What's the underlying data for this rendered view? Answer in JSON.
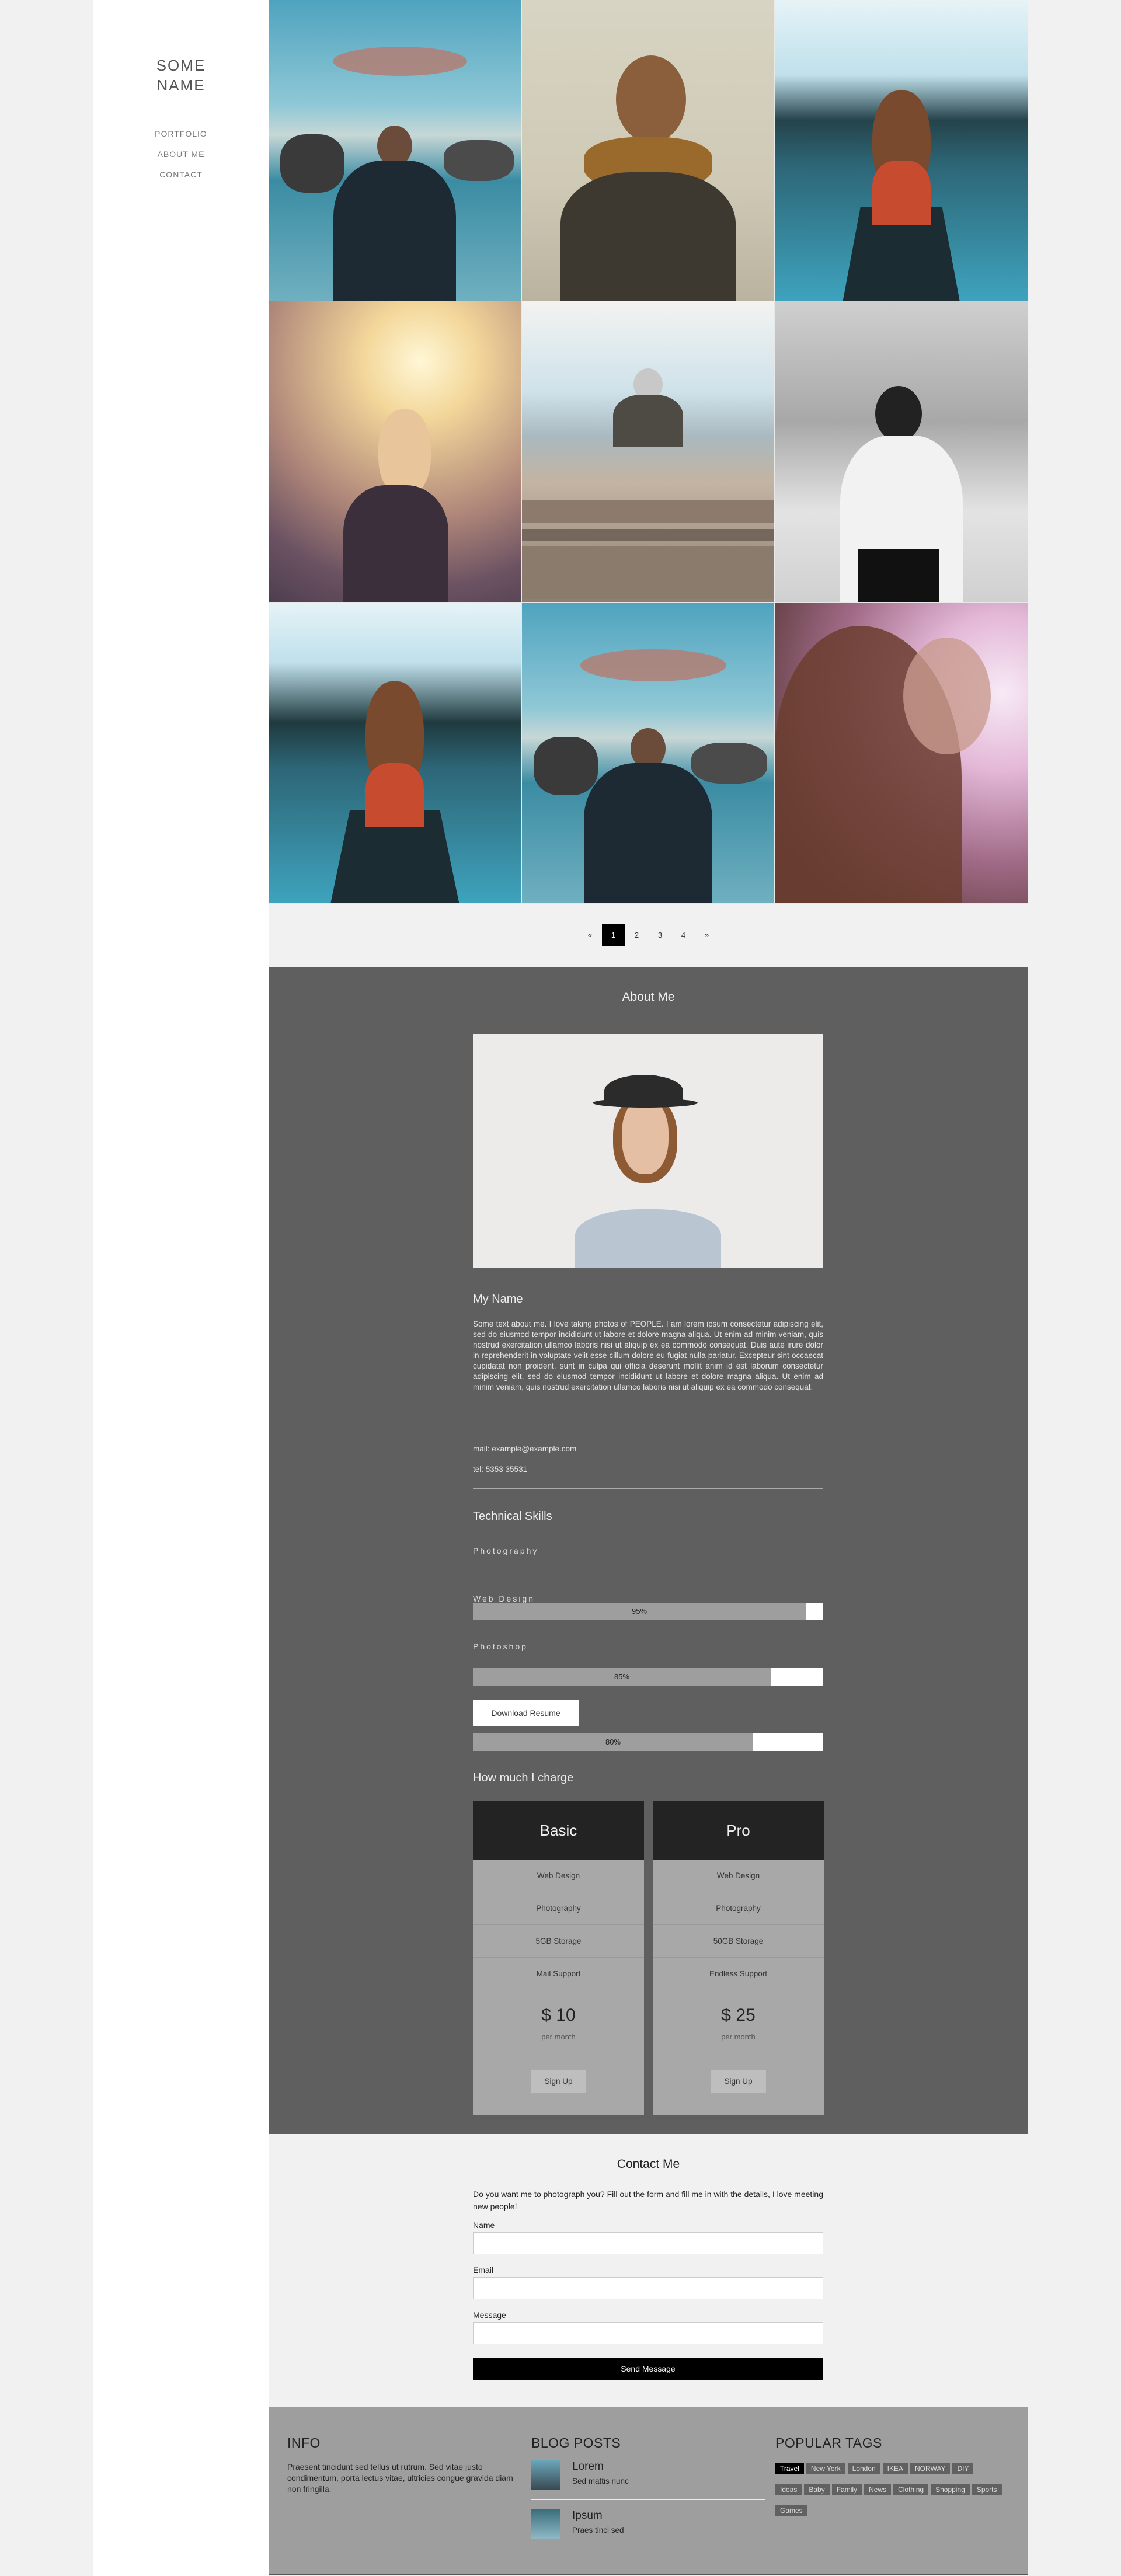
{
  "sidebar": {
    "brand_line1": "SOME",
    "brand_line2": "NAME",
    "nav": [
      "PORTFOLIO",
      "ABOUT ME",
      "CONTACT"
    ]
  },
  "pagination": {
    "prev": "«",
    "pages": [
      "1",
      "2",
      "3",
      "4"
    ],
    "active": "1",
    "next": "»"
  },
  "about": {
    "title": "About Me",
    "name": "My Name",
    "bio": "Some text about me. I love taking photos of PEOPLE. I am lorem ipsum consectetur adipiscing elit, sed do eiusmod tempor incididunt ut labore et dolore magna aliqua. Ut enim ad minim veniam, quis nostrud exercitation ullamco laboris nisi ut aliquip ex ea commodo consequat. Duis aute irure dolor in reprehenderit in voluptate velit esse cillum dolore eu fugiat nulla pariatur. Excepteur sint occaecat cupidatat non proident, sunt in culpa qui officia deserunt mollit anim id est laborum consectetur adipiscing elit, sed do eiusmod tempor incididunt ut labore et dolore magna aliqua. Ut enim ad minim veniam, quis nostrud exercitation ullamco laboris nisi ut aliquip ex ea commodo consequat.",
    "mail": "mail: example@example.com",
    "tel": "tel: 5353 35531"
  },
  "skills": {
    "title": "Technical Skills",
    "items": [
      {
        "label": "Photography",
        "value": 95,
        "text": "95%"
      },
      {
        "label": "Web Design",
        "value": 85,
        "text": "85%"
      },
      {
        "label": "Photoshop",
        "value": 80,
        "text": "80%"
      }
    ],
    "download": "Download Resume"
  },
  "pricing": {
    "title": "How much I charge",
    "plans": [
      {
        "name": "Basic",
        "features": [
          "Web Design",
          "Photography",
          "5GB Storage",
          "Mail Support"
        ],
        "price": "$ 10",
        "per": "per month",
        "cta": "Sign Up"
      },
      {
        "name": "Pro",
        "features": [
          "Web Design",
          "Photography",
          "50GB Storage",
          "Endless Support"
        ],
        "price": "$ 25",
        "per": "per month",
        "cta": "Sign Up"
      }
    ]
  },
  "contact": {
    "title": "Contact Me",
    "intro": "Do you want me to photograph you? Fill out the form and fill me in with the details, I love meeting new people!",
    "name_label": "Name",
    "email_label": "Email",
    "message_label": "Message",
    "send": "Send Message"
  },
  "footer": {
    "info_title": "INFO",
    "info_text": "Praesent tincidunt sed tellus ut rutrum. Sed vitae justo condimentum, porta lectus vitae, ultricies congue gravida diam non fringilla.",
    "blog_title": "BLOG POSTS",
    "posts": [
      {
        "title": "Lorem",
        "subtitle": "Sed mattis nunc"
      },
      {
        "title": "Ipsum",
        "subtitle": "Praes tinci sed"
      }
    ],
    "tags_title": "POPULAR TAGS",
    "tags": [
      "Travel",
      "New York",
      "London",
      "IKEA",
      "NORWAY",
      "DIY",
      "Ideas",
      "Baby",
      "Family",
      "News",
      "Clothing",
      "Shopping",
      "Sports",
      "Games"
    ],
    "active_tag": "Travel"
  },
  "colors": {
    "about_bg": "#5f5f5f",
    "footer_bg": "#9e9e9e",
    "plan_header": "#232323",
    "accent": "#000000"
  }
}
